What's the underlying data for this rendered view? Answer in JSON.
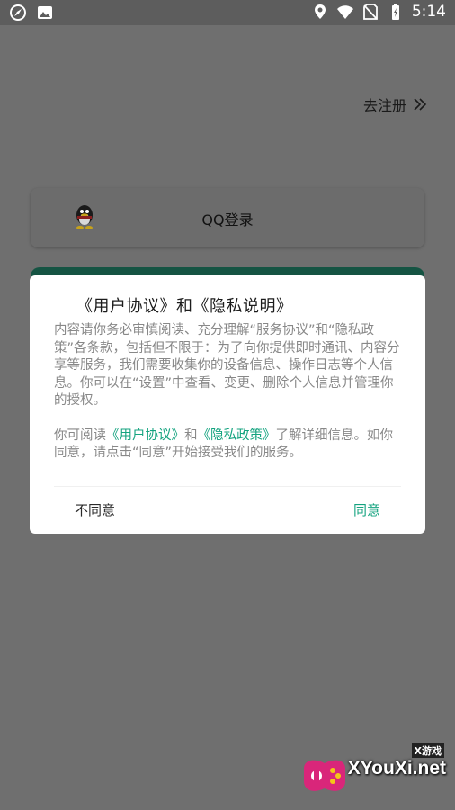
{
  "status_bar": {
    "time": "5:14",
    "left_icons": [
      "compass-icon",
      "image-icon"
    ],
    "right_icons": [
      "location-icon",
      "wifi-icon",
      "no-sim-icon",
      "battery-charging-icon"
    ]
  },
  "page": {
    "register_link": "去注册",
    "qq_login_label": "QQ登录"
  },
  "dialog": {
    "title": "《用户协议》和《隐私说明》",
    "paragraph1": "内容请你务必审慎阅读、充分理解“服务协议”和“隐私政策”各条款，包括但不限于：为了向你提供即时通讯、内容分享等服务，我们需要收集你的设备信息、操作日志等个人信息。你可以在“设置”中查看、变更、删除个人信息并管理你的授权。",
    "p2_prefix": "你可阅读",
    "p2_link1": "《用户协议》",
    "p2_and": "和",
    "p2_link2": "《隐私政策》",
    "p2_suffix": "了解详细信息。如你同意，请点击“同意”开始接受我们的服务。",
    "disagree_label": "不同意",
    "agree_label": "同意"
  },
  "watermark": {
    "top": "X游戏",
    "main": "XYouXi.net"
  },
  "colors": {
    "accent": "#14a37f",
    "overlay": "#6f6f6f",
    "dialog_bg": "#ffffff"
  }
}
